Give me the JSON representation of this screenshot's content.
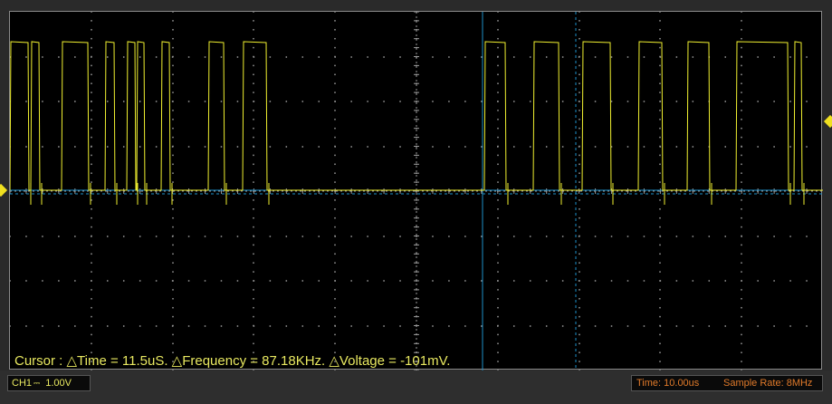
{
  "screen": {
    "cursor_readout": "Cursor :  △Time = 11.5uS.  △Frequency = 87.18KHz.  △Voltage = -101mV."
  },
  "status_bar": {
    "channel": "CH1",
    "channel_coupling": "⎓",
    "volts_per_div": "1.00V",
    "time_per_div": "Time: 10.00us",
    "sample_rate": "Sample Rate: 8MHz"
  },
  "colors": {
    "trace": "#f0f030",
    "cursor": "#1e90c8",
    "grid": "#b0b0b0",
    "readout_text": "#e8e860",
    "status_text": "#e07a2a"
  }
}
